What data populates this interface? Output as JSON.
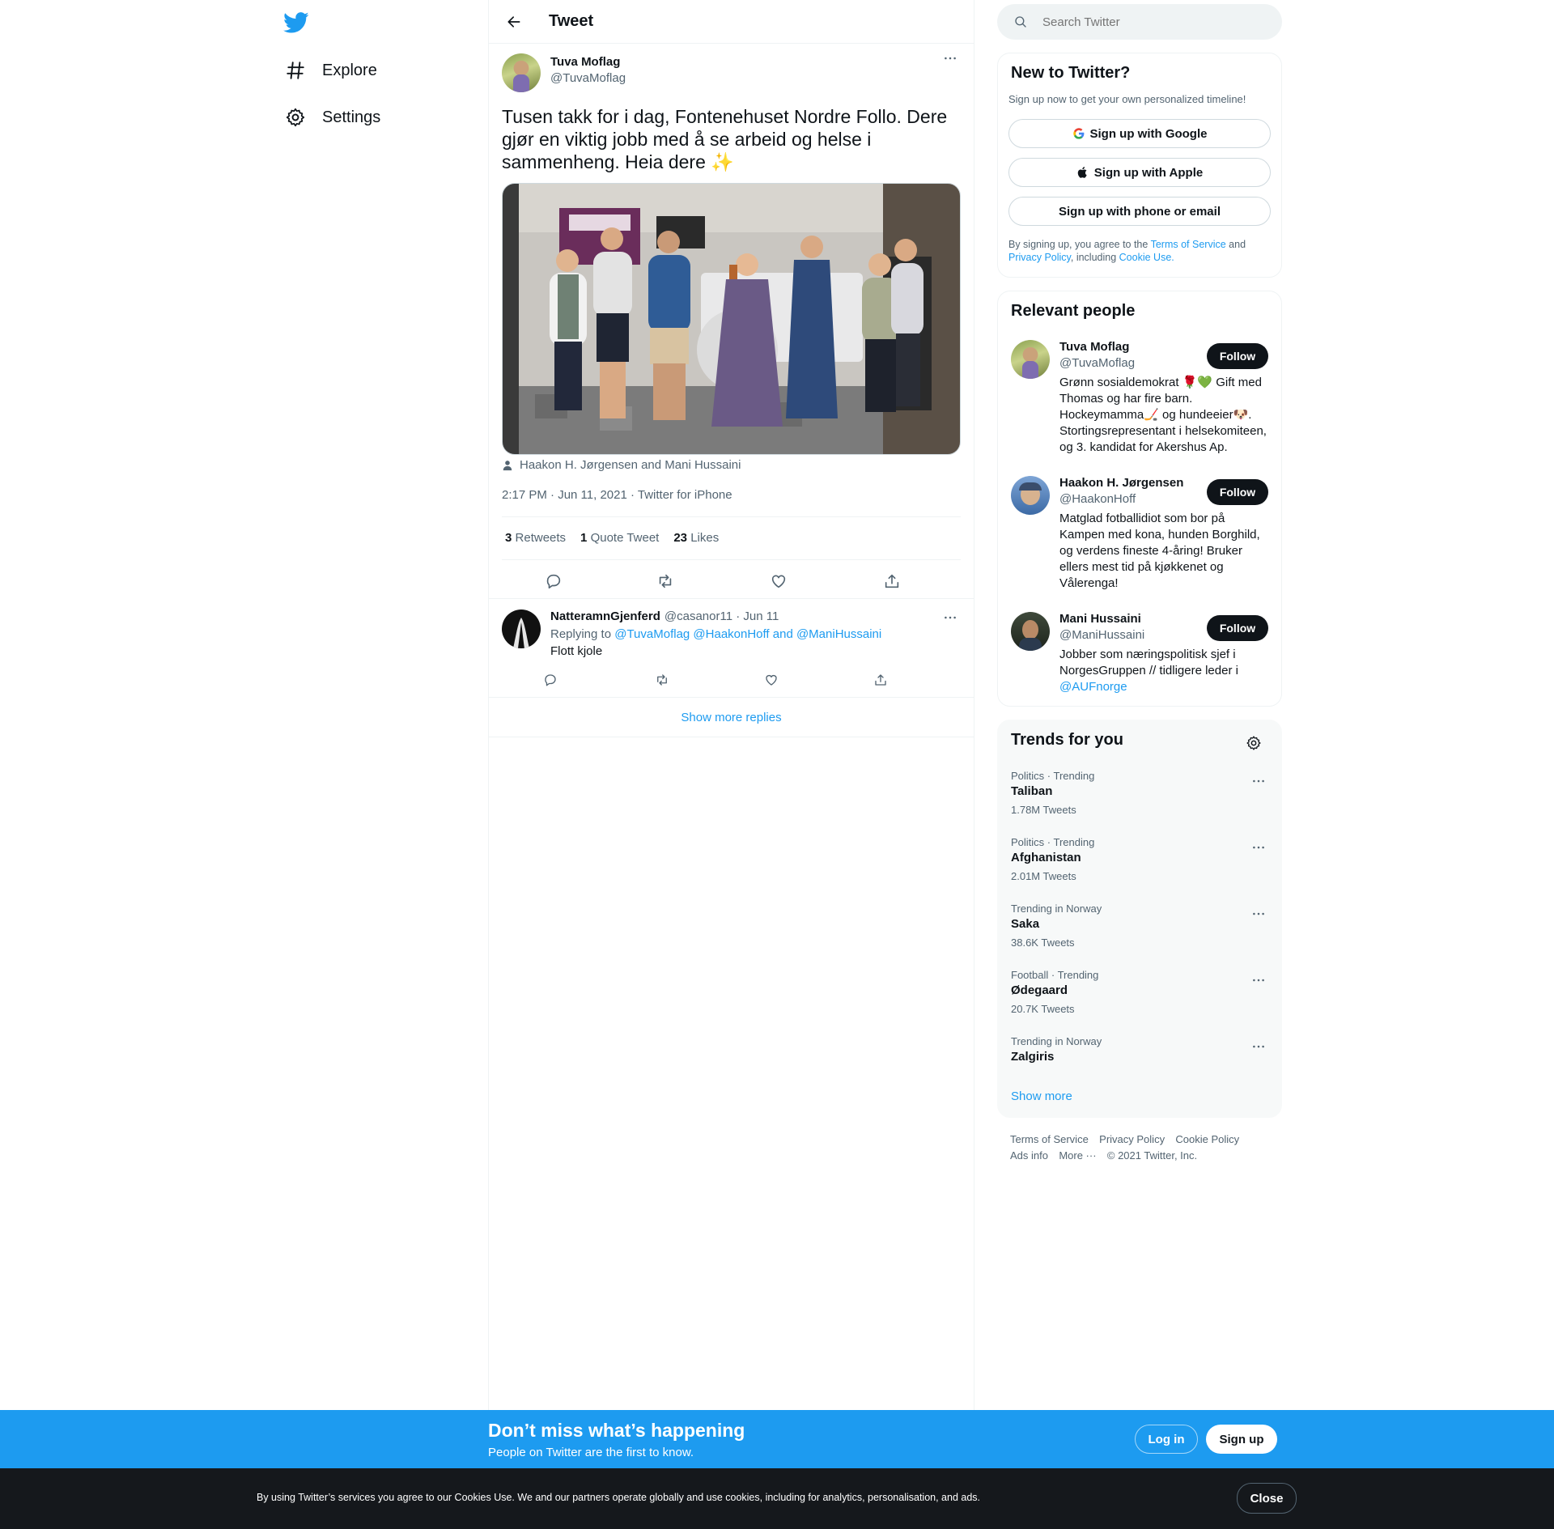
{
  "nav": {
    "items": [
      {
        "label": "Explore",
        "icon": "hashtag-icon"
      },
      {
        "label": "Settings",
        "icon": "gear-icon"
      }
    ]
  },
  "header": {
    "title": "Tweet"
  },
  "tweet": {
    "author_name": "Tuva Moflag",
    "author_handle": "@TuvaMoflag",
    "text": "Tusen takk for i dag, Fontenehuset Nordre Follo. Dere gjør en viktig jobb med å se arbeid og helse i sammenheng. Heia dere ✨",
    "tagged": "Haakon H. Jørgensen and Mani Hussaini",
    "timestamp": "2:17 PM · Jun 11, 2021 · Twitter for iPhone",
    "stats": [
      {
        "count": "3",
        "label": "Retweets"
      },
      {
        "count": "1",
        "label": "Quote Tweet"
      },
      {
        "count": "23",
        "label": "Likes"
      }
    ]
  },
  "reply": {
    "author_name": "NatteramnGjenferd",
    "meta": "@casanor11 · Jun 11",
    "replying_prefix": "Replying to",
    "replying_to": "@TuvaMoflag @HaakonHoff and @ManiHussaini",
    "text": "Flott kjole"
  },
  "show_more_replies": "Show more replies",
  "search": {
    "placeholder": "Search Twitter"
  },
  "signup_card": {
    "title": "New to Twitter?",
    "subtitle": "Sign up now to get your own personalized timeline!",
    "google": "Sign up with Google",
    "apple": "Sign up with Apple",
    "phone": "Sign up with phone or email",
    "legal_1": "By signing up, you agree to the",
    "terms": "Terms of Service",
    "legal_2": "and",
    "privacy": "Privacy Policy",
    "legal_3": ", including",
    "cookie": "Cookie Use."
  },
  "relevant": {
    "title": "Relevant people",
    "follow_label": "Follow",
    "people": [
      {
        "name": "Tuva Moflag",
        "handle": "@TuvaMoflag",
        "bio": "Grønn sosialdemokrat 🌹💚 Gift med Thomas og har fire barn. Hockeymamma🏒 og hundeeier🐶. Stortingsrepresentant i helsekomiteen, og 3. kandidat for Akershus Ap."
      },
      {
        "name": "Haakon H. Jørgensen",
        "handle": "@HaakonHoff",
        "bio": "Matglad fotballidiot som bor på Kampen med kona, hunden Borghild, og verdens fineste 4-åring! Bruker ellers mest tid på kjøkkenet og Vålerenga!"
      },
      {
        "name": "Mani Hussaini",
        "handle": "@ManiHussaini",
        "bio": "Jobber som næringspolitisk sjef i NorgesGruppen // tidligere leder i",
        "bio_link": "@AUFnorge"
      }
    ]
  },
  "trends": {
    "title": "Trends for you",
    "items": [
      {
        "context": "Politics · Trending",
        "name": "Taliban",
        "count": "1.78M Tweets"
      },
      {
        "context": "Politics · Trending",
        "name": "Afghanistan",
        "count": "2.01M Tweets"
      },
      {
        "context": "Trending in Norway",
        "name": "Saka",
        "count": "38.6K Tweets"
      },
      {
        "context": "Football · Trending",
        "name": "Ødegaard",
        "count": "20.7K Tweets"
      },
      {
        "context": "Trending in Norway",
        "name": "Zalgiris",
        "count": ""
      }
    ],
    "show_more": "Show more"
  },
  "footer": {
    "links": [
      "Terms of Service",
      "Privacy Policy",
      "Cookie Policy",
      "Ads info",
      "More ···"
    ],
    "copyright": "© 2021 Twitter, Inc."
  },
  "banner": {
    "title": "Don’t miss what’s happening",
    "subtitle": "People on Twitter are the first to know.",
    "login": "Log in",
    "signup": "Sign up"
  },
  "cookie_bar": {
    "text": "By using Twitter’s services you agree to our Cookies Use. We and our partners operate globally and use cookies, including for analytics, personalisation, and ads.",
    "close": "Close"
  },
  "colors": {
    "accent": "#1d9bf0",
    "text": "#0f1419",
    "muted": "#536471",
    "border": "#eff3f4",
    "cookie_bg": "#15181c"
  }
}
